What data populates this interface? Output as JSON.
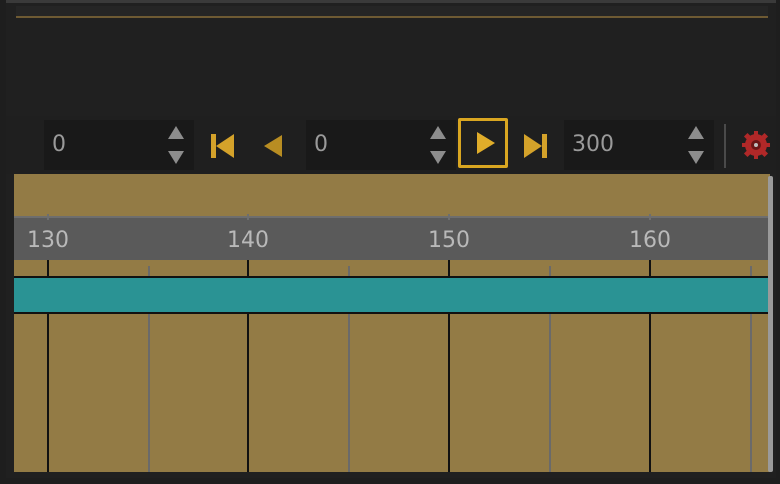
{
  "playback": {
    "start_frame": "0",
    "current_frame": "0",
    "end_frame": "300"
  },
  "buttons": {
    "first_frame_icon": "skip-to-start-icon",
    "step_back_icon": "step-back-icon",
    "play_icon": "play-icon",
    "last_frame_icon": "skip-to-end-icon",
    "settings_icon": "gear-icon"
  },
  "timeline": {
    "ruler_labels": [
      "130",
      "140",
      "150",
      "160"
    ]
  },
  "colors": {
    "accent": "#d9a621",
    "timeline_bg": "#937b45",
    "track": "#2a9394",
    "ruler": "#5a5a5a"
  }
}
